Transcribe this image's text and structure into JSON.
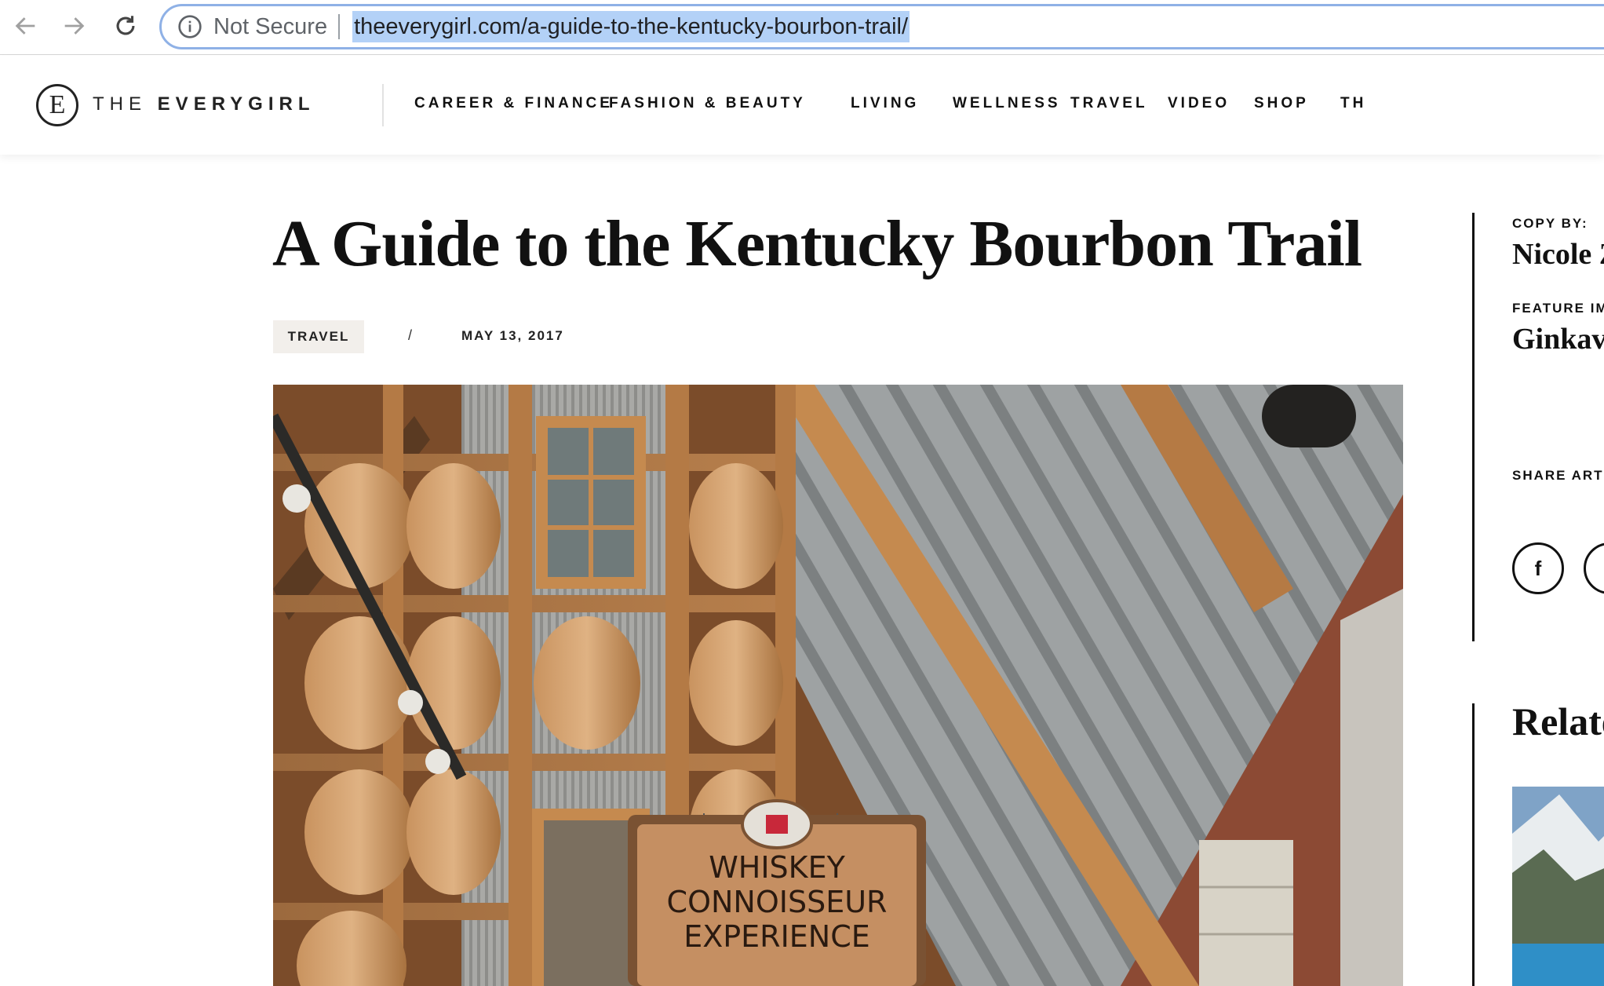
{
  "browser": {
    "security_label": "Not Secure",
    "url": "theeverygirl.com/a-guide-to-the-kentucky-bourbon-trail/"
  },
  "site": {
    "logo_mark": "E",
    "logo_word_1": "THE",
    "logo_word_2": "EVERYGIRL",
    "nav": [
      "CAREER & FINANCE",
      "FASHION & BEAUTY",
      "LIVING",
      "WELLNESS",
      "TRAVEL",
      "VIDEO",
      "SHOP",
      "TH"
    ]
  },
  "article": {
    "title": "A Guide to the Kentucky Bourbon Trail",
    "category": "TRAVEL",
    "separator": "/",
    "date": "MAY 13, 2017",
    "hero_sign_line1": "WHISKEY",
    "hero_sign_line2": "CONNOISSEUR",
    "hero_sign_line3": "EXPERIENCE"
  },
  "sidebar": {
    "copy_by_label": "COPY BY:",
    "copy_by_name": "Nicole Z",
    "feature_label": "FEATURE IM",
    "feature_name": "Ginkav",
    "share_label": "SHARE ARTI",
    "share_facebook": "f",
    "related_title": "Relate"
  },
  "colors": {
    "url_highlight": "#b3d1f7",
    "urlbar_border": "#8fb1e6",
    "tag_background": "#f2efeb"
  }
}
